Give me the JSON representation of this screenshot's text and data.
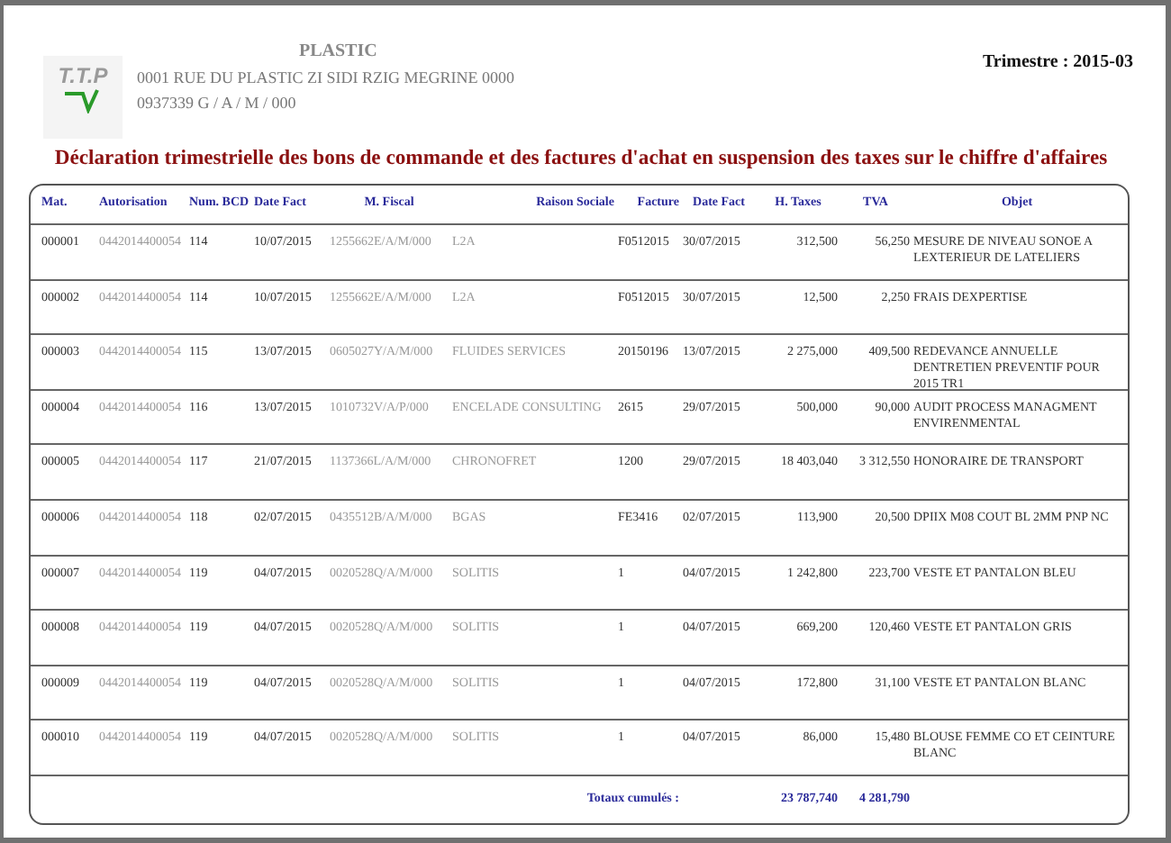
{
  "header": {
    "company_name": "PLASTIC",
    "address": "0001 RUE DU PLASTIC ZI SIDI RZIG MEGRINE 0000",
    "fiscal_id": "0937339 G / A / M / 000",
    "logo_text": "T.T.P",
    "period": "Trimestre : 2015-03"
  },
  "title": "Déclaration trimestrielle des bons de commande et des factures d'achat en suspension des taxes sur le chiffre d'affaires",
  "table": {
    "columns": [
      "Mat.",
      "Autorisation",
      "Num. BCD",
      "Date Fact",
      "M. Fiscal",
      "Raison Sociale",
      "Facture",
      "Date Fact",
      "H. Taxes",
      "TVA",
      "Objet"
    ],
    "rows": [
      [
        "000001",
        "0442014400054",
        "114",
        "10/07/2015",
        "1255662E/A/M/000",
        "L2A",
        "F0512015",
        "30/07/2015",
        "312,500",
        "56,250",
        "MESURE DE NIVEAU SONOE A LEXTERIEUR DE LATELIERS"
      ],
      [
        "000002",
        "0442014400054",
        "114",
        "10/07/2015",
        "1255662E/A/M/000",
        "L2A",
        "F0512015",
        "30/07/2015",
        "12,500",
        "2,250",
        "FRAIS DEXPERTISE"
      ],
      [
        "000003",
        "0442014400054",
        "115",
        "13/07/2015",
        "0605027Y/A/M/000",
        "FLUIDES SERVICES",
        "20150196",
        "13/07/2015",
        "2 275,000",
        "409,500",
        "REDEVANCE ANNUELLE DENTRETIEN PREVENTIF POUR 2015 TR1"
      ],
      [
        "000004",
        "0442014400054",
        "116",
        "13/07/2015",
        "1010732V/A/P/000",
        "ENCELADE CONSULTING",
        "2615",
        "29/07/2015",
        "500,000",
        "90,000",
        "AUDIT PROCESS MANAGMENT ENVIRENMENTAL"
      ],
      [
        "000005",
        "0442014400054",
        "117",
        "21/07/2015",
        "1137366L/A/M/000",
        "CHRONOFRET",
        "1200",
        "29/07/2015",
        "18 403,040",
        "3 312,550",
        "HONORAIRE DE TRANSPORT"
      ],
      [
        "000006",
        "0442014400054",
        "118",
        "02/07/2015",
        "0435512B/A/M/000",
        "BGAS",
        "FE3416",
        "02/07/2015",
        "113,900",
        "20,500",
        "DPIIX M08 COUT BL 2MM PNP NC"
      ],
      [
        "000007",
        "0442014400054",
        "119",
        "04/07/2015",
        "0020528Q/A/M/000",
        "SOLITIS",
        "1",
        "04/07/2015",
        "1 242,800",
        "223,700",
        "VESTE ET PANTALON BLEU"
      ],
      [
        "000008",
        "0442014400054",
        "119",
        "04/07/2015",
        "0020528Q/A/M/000",
        "SOLITIS",
        "1",
        "04/07/2015",
        "669,200",
        "120,460",
        "VESTE ET PANTALON GRIS"
      ],
      [
        "000009",
        "0442014400054",
        "119",
        "04/07/2015",
        "0020528Q/A/M/000",
        "SOLITIS",
        "1",
        "04/07/2015",
        "172,800",
        "31,100",
        "VESTE ET PANTALON BLANC"
      ],
      [
        "000010",
        "0442014400054",
        "119",
        "04/07/2015",
        "0020528Q/A/M/000",
        "SOLITIS",
        "1",
        "04/07/2015",
        "86,000",
        "15,480",
        "BLOUSE FEMME CO ET CEINTURE BLANC"
      ]
    ],
    "totals": {
      "label": "Totaux cumulés :",
      "h_taxes": "23 787,740",
      "tva": "4 281,790"
    }
  }
}
